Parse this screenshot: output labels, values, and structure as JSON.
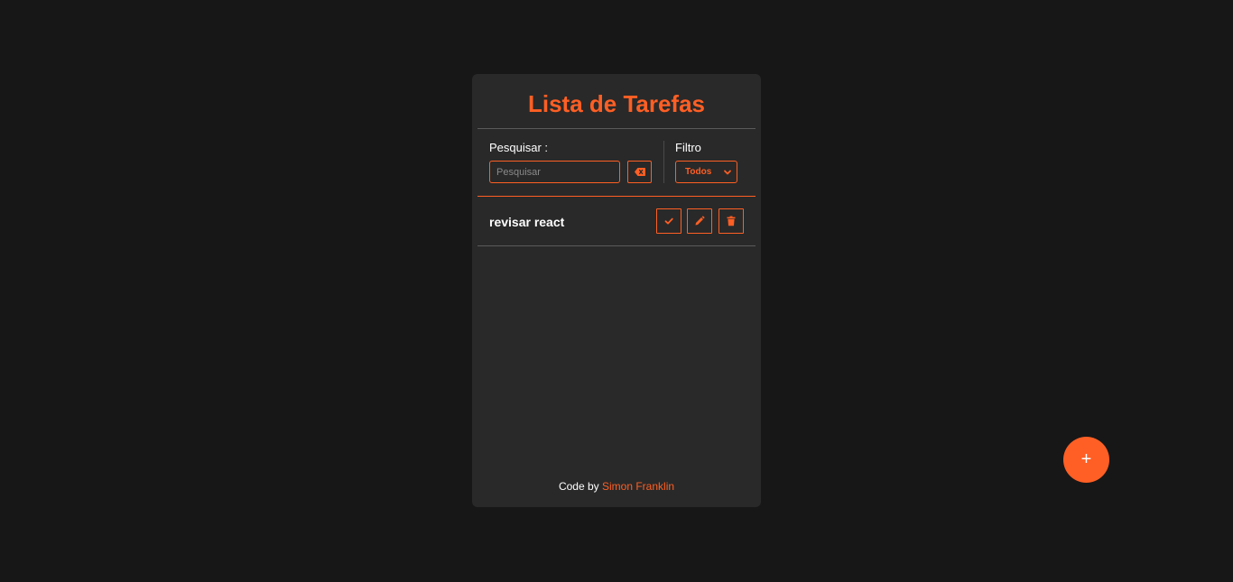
{
  "app": {
    "title": "Lista de Tarefas"
  },
  "search": {
    "label": "Pesquisar :",
    "placeholder": "Pesquisar",
    "value": "",
    "clear_icon": "backspace-icon"
  },
  "filter": {
    "label": "Filtro",
    "selected": "Todos",
    "icon": "chevron-down-icon"
  },
  "todos": [
    {
      "text": "revisar react",
      "actions": [
        "check-icon",
        "pencil-icon",
        "trash-icon"
      ]
    }
  ],
  "footer": {
    "prefix": "Code by",
    "author": "Simon Franklin"
  },
  "fab": {
    "label": "+"
  },
  "colors": {
    "accent": "#ff5f24",
    "background": "#171717",
    "card": "#292929"
  }
}
